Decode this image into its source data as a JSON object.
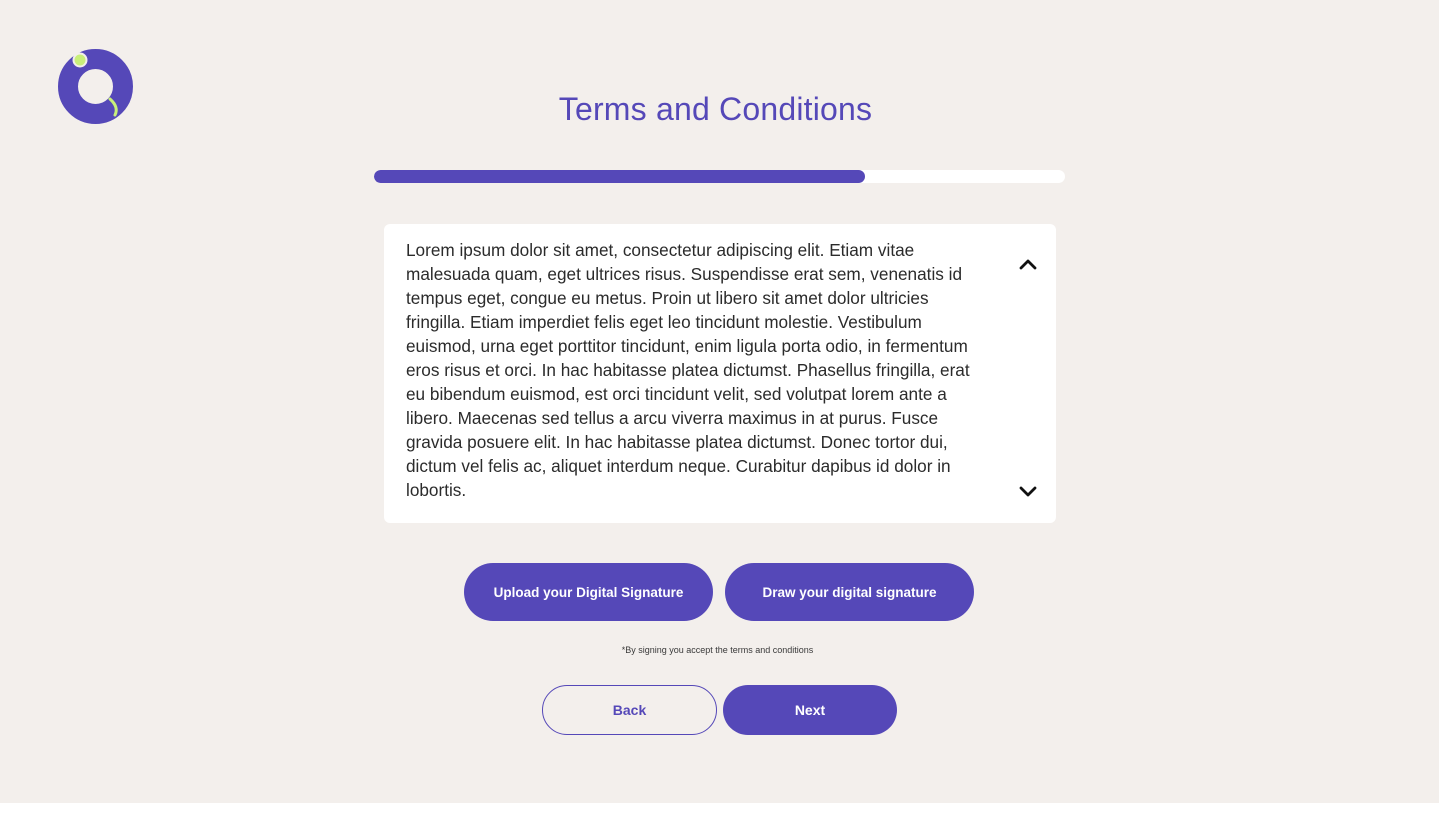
{
  "header": {
    "title": "Terms and Conditions",
    "logo_icon": "brand-ring-logo-icon"
  },
  "progress": {
    "fraction": 0.71
  },
  "terms": {
    "text": "Lorem ipsum dolor sit amet, consectetur adipiscing elit. Etiam vitae malesuada quam, eget ultrices risus. Suspendisse erat sem, venenatis id tempus eget, congue eu metus. Proin ut libero sit amet dolor ultricies fringilla. Etiam imperdiet felis eget leo tincidunt molestie. Vestibulum euismod, urna eget porttitor tincidunt, enim ligula porta odio, in fermentum eros risus et orci. In hac habitasse platea dictumst. Phasellus fringilla, erat eu bibendum euismod, est orci tincidunt velit, sed volutpat lorem ante a libero. Maecenas sed tellus a arcu viverra maximus in at purus. Fusce gravida posuere elit. In hac habitasse platea dictumst. Donec tortor dui, dictum vel felis ac, aliquet interdum neque. Curabitur dapibus id dolor in lobortis.",
    "scroll_up_icon": "chevron-up-icon",
    "scroll_down_icon": "chevron-down-icon"
  },
  "signature": {
    "upload_label": "Upload your Digital Signature",
    "draw_label": "Draw your digital signature",
    "note": "*By signing you accept the terms and conditions"
  },
  "nav": {
    "back_label": "Back",
    "next_label": "Next"
  },
  "colors": {
    "brand": "#5548b8",
    "accent": "#c9ef7a",
    "background": "#f3efec",
    "surface": "#ffffff"
  }
}
